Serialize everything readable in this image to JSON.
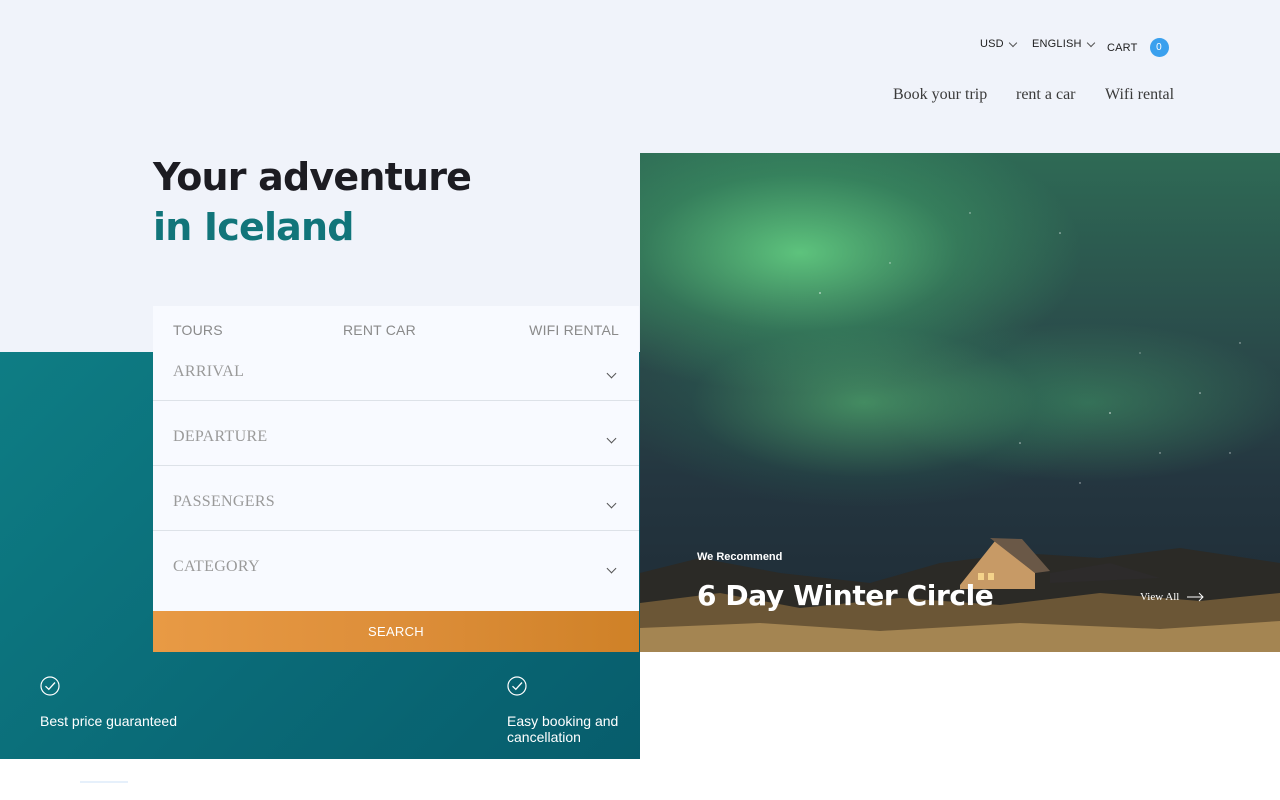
{
  "topbar": {
    "currency": "USD",
    "language": "ENGLISH",
    "cart_label": "CART",
    "cart_count": "0"
  },
  "nav": {
    "items": [
      {
        "label": "Book your trip"
      },
      {
        "label": "rent a car"
      },
      {
        "label": "Wifi rental"
      }
    ]
  },
  "hero": {
    "line1": "Your adventure",
    "line2": "in Iceland"
  },
  "booking": {
    "tabs": [
      {
        "label": "TOURS"
      },
      {
        "label": "RENT CAR"
      },
      {
        "label": "WIFI RENTAL"
      }
    ],
    "fields": [
      {
        "label": "ARRIVAL"
      },
      {
        "label": "DEPARTURE"
      },
      {
        "label": "PASSENGERS"
      },
      {
        "label": "CATEGORY"
      }
    ],
    "search_label": "SEARCH"
  },
  "features": [
    {
      "icon": "check-circle-icon",
      "text": "Best price guaranteed"
    },
    {
      "icon": "check-circle-icon",
      "text": "Easy booking and cancellation"
    }
  ],
  "promo": {
    "kicker": "We Recommend",
    "title": "6 Day Winter Circle",
    "view_all": "View All"
  },
  "colors": {
    "teal": "#11757a",
    "orange": "#e2913c",
    "cart_badge": "#3aa0ee",
    "page_bg": "#f0f3fa"
  }
}
